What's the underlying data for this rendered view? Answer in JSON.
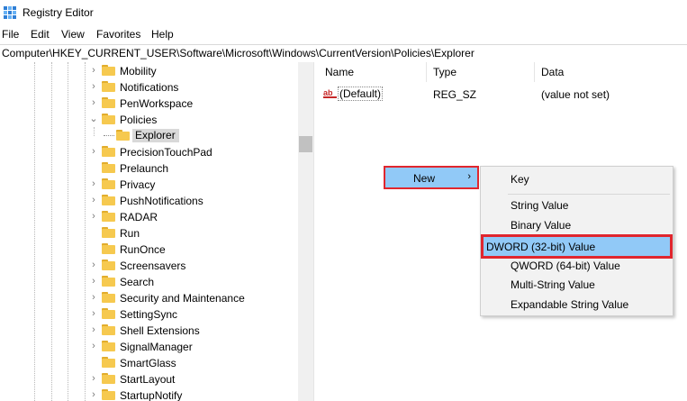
{
  "app": {
    "title": "Registry Editor"
  },
  "menu": [
    "File",
    "Edit",
    "View",
    "Favorites",
    "Help"
  ],
  "address": "Computer\\HKEY_CURRENT_USER\\Software\\Microsoft\\Windows\\CurrentVersion\\Policies\\Explorer",
  "tree": {
    "items": [
      {
        "label": "Mobility",
        "state": "collapsed"
      },
      {
        "label": "Notifications",
        "state": "collapsed"
      },
      {
        "label": "PenWorkspace",
        "state": "collapsed"
      },
      {
        "label": "Policies",
        "state": "expanded"
      },
      {
        "label": "Explorer",
        "state": "selected-child"
      },
      {
        "label": "PrecisionTouchPad",
        "state": "collapsed"
      },
      {
        "label": "Prelaunch",
        "state": "leaf"
      },
      {
        "label": "Privacy",
        "state": "collapsed"
      },
      {
        "label": "PushNotifications",
        "state": "collapsed"
      },
      {
        "label": "RADAR",
        "state": "collapsed"
      },
      {
        "label": "Run",
        "state": "leaf"
      },
      {
        "label": "RunOnce",
        "state": "leaf"
      },
      {
        "label": "Screensavers",
        "state": "collapsed"
      },
      {
        "label": "Search",
        "state": "collapsed"
      },
      {
        "label": "Security and Maintenance",
        "state": "collapsed"
      },
      {
        "label": "SettingSync",
        "state": "collapsed"
      },
      {
        "label": "Shell Extensions",
        "state": "collapsed"
      },
      {
        "label": "SignalManager",
        "state": "collapsed"
      },
      {
        "label": "SmartGlass",
        "state": "leaf"
      },
      {
        "label": "StartLayout",
        "state": "collapsed"
      },
      {
        "label": "StartupNotify",
        "state": "collapsed"
      }
    ]
  },
  "columns": {
    "name": "Name",
    "type": "Type",
    "data": "Data"
  },
  "value": {
    "name": "(Default)",
    "type": "REG_SZ",
    "data": "(value not set)",
    "icon_text": "ab"
  },
  "context_menu": {
    "new_label": "New",
    "arrow": "›",
    "items": [
      "Key",
      "String Value",
      "Binary Value",
      "DWORD (32-bit) Value",
      "QWORD (64-bit) Value",
      "Multi-String Value",
      "Expandable String Value"
    ]
  },
  "colors": {
    "accent": "#91c9f7",
    "highlight_border": "#e0262e",
    "folder": "#f6c94f"
  }
}
